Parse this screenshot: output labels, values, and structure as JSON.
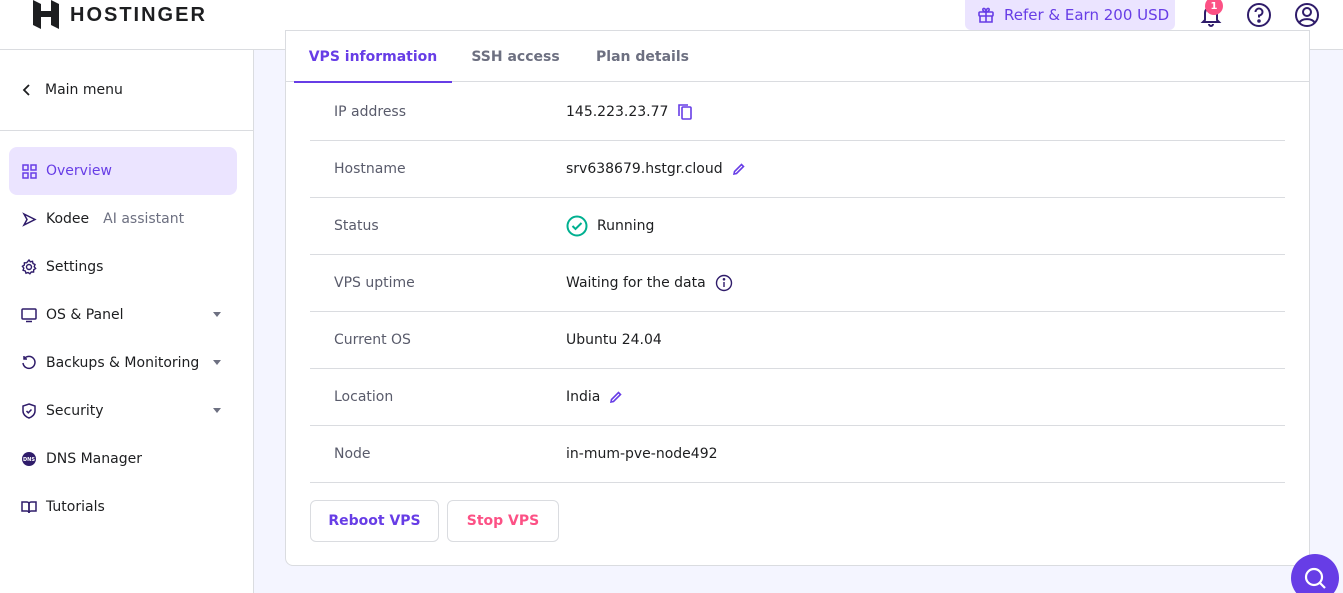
{
  "header": {
    "brand": "HOSTINGER",
    "refer_label": "Refer & Earn 200 USD",
    "notification_count": "1"
  },
  "sidebar": {
    "main_menu": "Main menu",
    "items": [
      {
        "label": "Overview",
        "icon": "grid-icon",
        "active": true
      },
      {
        "label": "Kodee",
        "sub": "AI assistant",
        "icon": "kodee-icon"
      },
      {
        "label": "Settings",
        "icon": "gear-icon"
      },
      {
        "label": "OS & Panel",
        "icon": "monitor-icon",
        "expandable": true
      },
      {
        "label": "Backups & Monitoring",
        "icon": "restore-icon",
        "expandable": true
      },
      {
        "label": "Security",
        "icon": "shield-icon",
        "expandable": true
      },
      {
        "label": "DNS Manager",
        "icon": "dns-icon"
      },
      {
        "label": "Tutorials",
        "icon": "book-icon"
      }
    ]
  },
  "tabs": [
    "VPS information",
    "SSH access",
    "Plan details"
  ],
  "info": {
    "ip_label": "IP address",
    "ip_value": "145.223.23.77",
    "hostname_label": "Hostname",
    "hostname_value": "srv638679.hstgr.cloud",
    "status_label": "Status",
    "status_value": "Running",
    "uptime_label": "VPS uptime",
    "uptime_value": "Waiting for the data",
    "os_label": "Current OS",
    "os_value": "Ubuntu 24.04",
    "location_label": "Location",
    "location_value": "India",
    "node_label": "Node",
    "node_value": "in-mum-pve-node492"
  },
  "actions": {
    "reboot": "Reboot VPS",
    "stop": "Stop VPS"
  },
  "colors": {
    "accent": "#673de6",
    "danger": "#fc5185",
    "success": "#00b090"
  }
}
